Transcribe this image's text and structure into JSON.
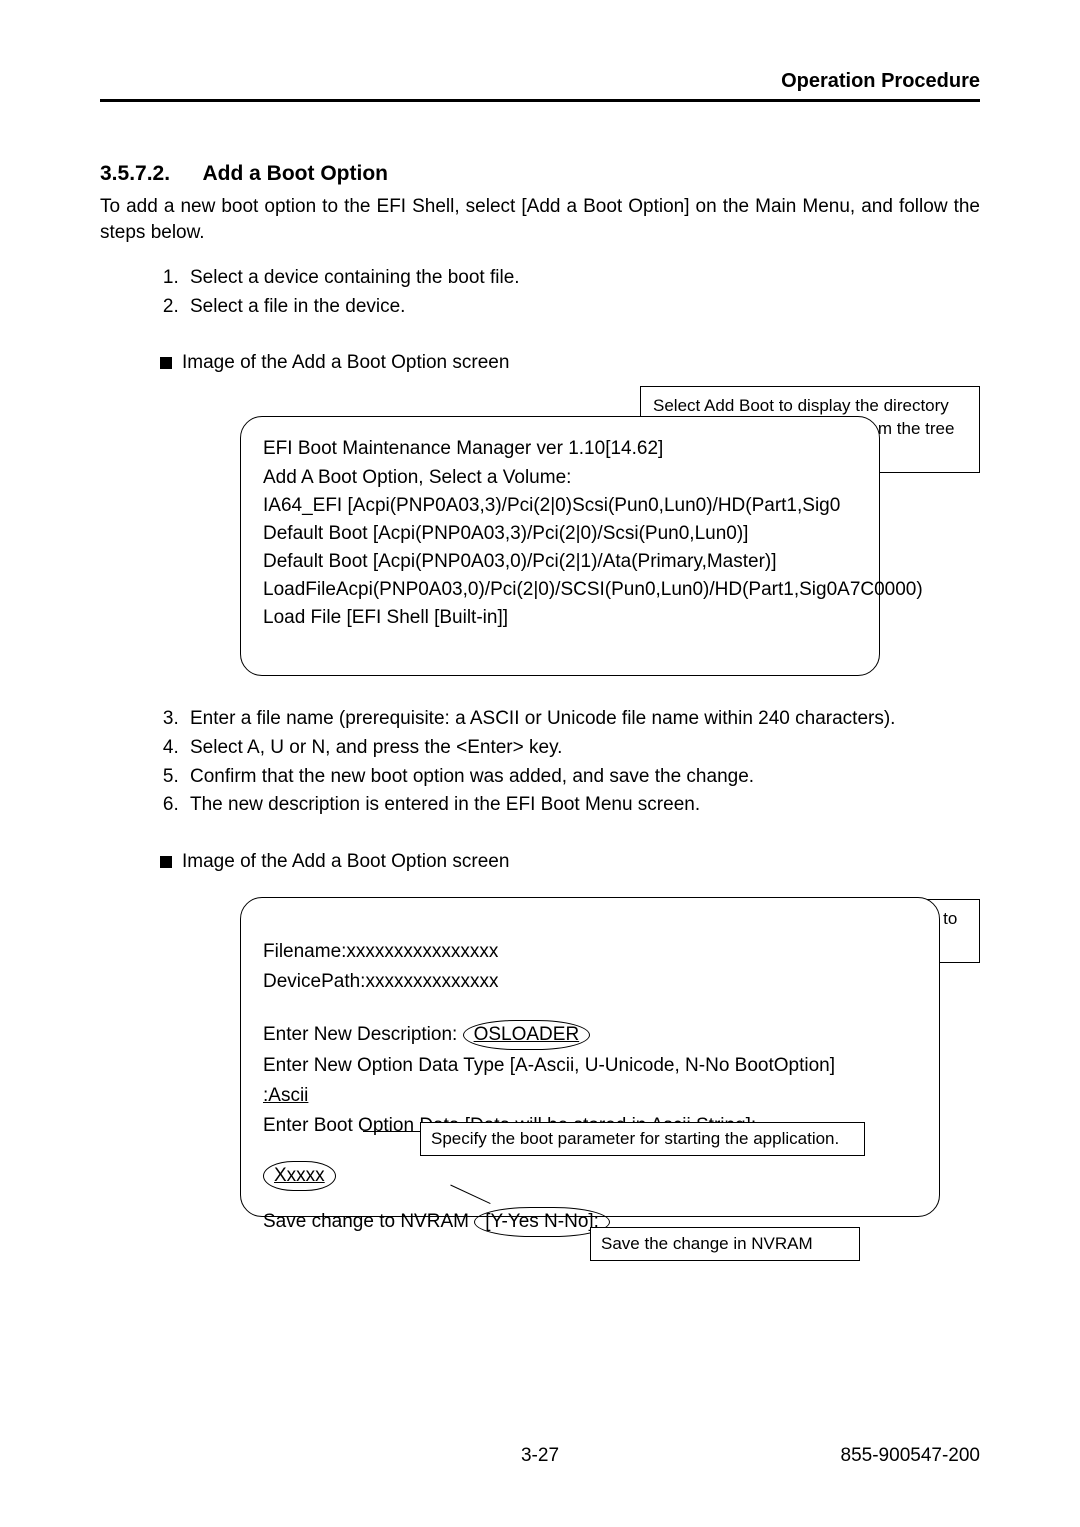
{
  "running_head": "Operation Procedure",
  "section_number": "3.5.7.2.",
  "section_title": "Add a Boot Option",
  "intro": "To add a new boot option to the EFI Shell, select [Add a Boot Option] on the Main Menu, and follow the steps below.",
  "steps_a": [
    "Select a device containing the boot file.",
    "Select a file in the device."
  ],
  "image_caption": "Image of the Add a Boot Option screen",
  "callout1": "Select Add Boot to display the directory tree, and select a directory from the tree to enter the boot program.",
  "screen1": [
    "EFI Boot Maintenance Manager ver 1.10[14.62]",
    "Add A Boot Option, Select a Volume:",
    "IA64_EFI [Acpi(PNP0A03,3)/Pci(2|0)Scsi(Pun0,Lun0)/HD(Part1,Sig0",
    "Default Boot [Acpi(PNP0A03,3)/Pci(2|0)/Scsi(Pun0,Lun0)]",
    "Default Boot [Acpi(PNP0A03,0)/Pci(2|1)/Ata(Primary,Master)]",
    "LoadFileAcpi(PNP0A03,0)/Pci(2|0)/SCSI(Pun0,Lun0)/HD(Part1,Sig0A7C0000)",
    "Load File [EFI Shell [Built-in]]"
  ],
  "steps_b": [
    "Enter a file name (prerequisite: a ASCII or Unicode file name within 240 characters).",
    "Select A, U or N, and press the <Enter> key.",
    "Confirm that the new boot option was added, and save the change.",
    "The new description is entered in the EFI Boot Menu screen."
  ],
  "callout2a": "Specify the title of the new description to enter in the EFI Boot Manger.",
  "callout2b": "Specify the boot parameter for starting the application.",
  "callout2c": "Save the change in NVRAM",
  "screen2": {
    "filename_label": "Filename:",
    "filename_value": "xxxxxxxxxxxxxxxx",
    "devicepath_label": "DevicePath:",
    "devicepath_value": "xxxxxxxxxxxxxx",
    "desc_label": "Enter New Description:",
    "desc_value": "OSLOADER",
    "type_line": "Enter New Option Data Type [A-Ascii, U-Unicode, N-No BootOption]",
    "type_value": ":Ascii",
    "bootdata_line": "Enter Boot Option Data [Data will be stored in Ascii String]:",
    "bootdata_value": "Xxxxx",
    "save_label": "Save change to NVRAM",
    "save_value": "[Y-Yes N-No]:"
  },
  "footer_page": "3-27",
  "footer_doc": "855-900547-200"
}
